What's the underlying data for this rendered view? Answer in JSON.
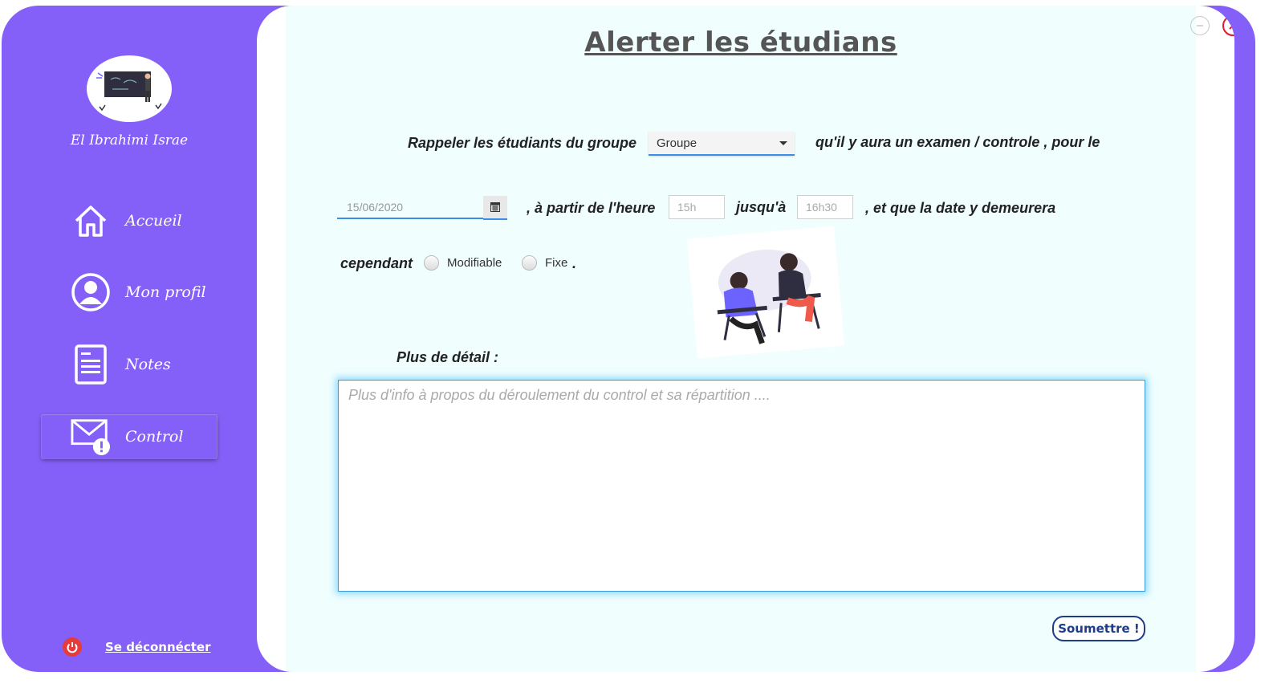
{
  "sidebar": {
    "username": "El Ibrahimi Israe",
    "items": [
      {
        "label": "Accueil",
        "icon": "home-icon"
      },
      {
        "label": "Mon profil",
        "icon": "user-icon"
      },
      {
        "label": "Notes",
        "icon": "document-icon"
      },
      {
        "label": "Control",
        "icon": "mail-alert-icon",
        "active": true
      }
    ],
    "logout_label": "Se déconnécter"
  },
  "main": {
    "title": "Alerter les étudians",
    "sentence": {
      "part1": "Rappeler les étudiants du groupe",
      "part2": "qu'il y aura un examen / controle , pour le",
      "part3": ", à partir de l'heure",
      "part4": "jusqu'à",
      "part5": ", et que la date y demeurera",
      "part6": "cependant",
      "part7": "."
    },
    "group_select": {
      "value": "Groupe"
    },
    "date": {
      "value": "15/06/2020"
    },
    "start_time": {
      "placeholder": "15h"
    },
    "end_time": {
      "placeholder": "16h30"
    },
    "radios": [
      {
        "label": "Modifiable",
        "checked": false
      },
      {
        "label": "Fixe",
        "checked": false
      }
    ],
    "detail_label": "Plus de détail :",
    "detail_placeholder": "Plus d'info à propos du déroulement du control et sa répartition ....",
    "submit_label": "Soumettre !"
  },
  "colors": {
    "sidebar_bg": "#8560f8",
    "panel_bg": "#f0fefe",
    "accent_blue": "#3a8ee8",
    "close_red": "#e0192f",
    "submit_blue": "#1e3c8a"
  }
}
